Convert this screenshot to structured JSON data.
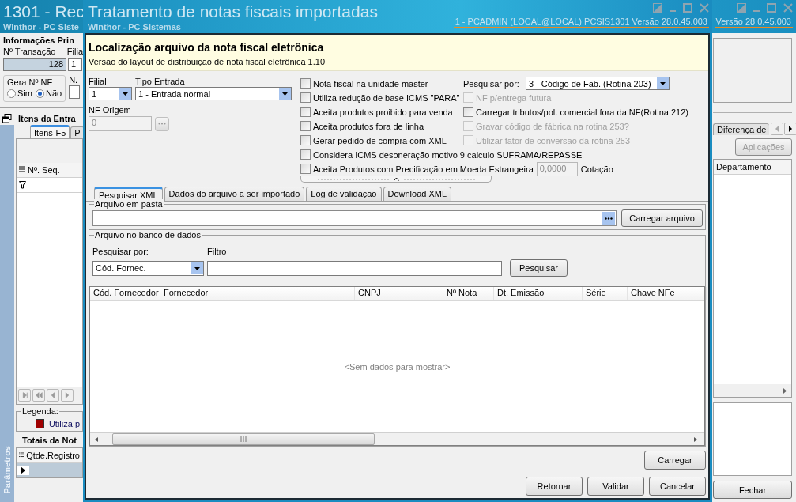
{
  "background_window": {
    "title": "1301 - Rec",
    "subtitle": "Winthor - PC Siste",
    "version": "Versão  28.0.45.003",
    "left": {
      "section_title": "Informações Prin",
      "transacao_label": "Nº Transação",
      "transacao_value": "128",
      "filial_label": "Filia",
      "filial_value": "1",
      "gera_nf_title": "Gera Nº NF",
      "gera_nf_options": [
        {
          "label": "Sim",
          "selected": false
        },
        {
          "label": "Não",
          "selected": true
        }
      ],
      "n_label": "N.",
      "itens_title": "Itens da Entra",
      "tabs": [
        {
          "label": "Itens-F5",
          "selected": true
        },
        {
          "label": "P",
          "selected": false
        }
      ],
      "grid_column": "Nº. Seq.",
      "legend_title": "Legenda:",
      "legend_items": [
        {
          "label": "Utiliza p",
          "color": "#a00000"
        }
      ],
      "totais_title": "Totais da Not",
      "totais_column": "Qtde.Registro",
      "side_tab": "Parâmetros"
    },
    "right": {
      "tab": "Diferença de",
      "button": "Aplicações",
      "grid_column": "Departamento",
      "close_button": "Fechar"
    }
  },
  "dialog": {
    "title": "Tratamento de notas fiscais importadas",
    "subtitle": "Winthor - PC Sistemas",
    "status": "1 - PCADMIN (LOCAL@LOCAL)   PCSIS1301  Versão  28.0.45.003",
    "header_title": "Localização arquivo da nota fiscal eletrônica",
    "header_subtitle": "Versão do layout de distribuição de nota fiscal eletrônica 1.10",
    "filial": {
      "label": "Filial",
      "value": "1"
    },
    "tipo_entrada": {
      "label": "Tipo Entrada",
      "value": "1 - Entrada normal"
    },
    "nf_origem": {
      "label": "NF Origem",
      "value": "0"
    },
    "left_checkboxes": [
      {
        "label": "Nota fiscal na unidade master",
        "checked": false,
        "disabled": false
      },
      {
        "label": "Utiliza redução de base ICMS \"PARA\"",
        "checked": false,
        "disabled": false
      },
      {
        "label": "Aceita produtos proibido para venda",
        "checked": false,
        "disabled": false
      },
      {
        "label": "Aceita produtos fora de linha",
        "checked": false,
        "disabled": false
      },
      {
        "label": "Gerar pedido de compra com XML",
        "checked": false,
        "disabled": false
      },
      {
        "label": "Considera ICMS desoneração motivo 9 calculo SUFRAMA/REPASSE",
        "checked": false,
        "disabled": false
      },
      {
        "label": "Aceita Produtos com Precificação em Moeda Estrangeira",
        "checked": false,
        "disabled": false
      }
    ],
    "pesquisar_por": {
      "label": "Pesquisar por:",
      "value": "3 - Código de Fab. (Rotina 203)"
    },
    "right_checkboxes": [
      {
        "label": "NF p/entrega futura",
        "checked": false,
        "disabled": true
      },
      {
        "label": "Carregar tributos/pol. comercial fora da NF(Rotina 212)",
        "checked": false,
        "disabled": false
      },
      {
        "label": "Gravar código de fábrica na rotina 253?",
        "checked": false,
        "disabled": true
      },
      {
        "label": "Utilizar fator de conversão da rotina 253",
        "checked": false,
        "disabled": true
      }
    ],
    "cotacao": {
      "value": "0,0000",
      "label": "Cotação"
    },
    "tabs": [
      {
        "label": "Pesquisar XML",
        "selected": true
      },
      {
        "label": "Dados do arquivo a ser importado",
        "selected": false
      },
      {
        "label": "Log de validação",
        "selected": false
      },
      {
        "label": "Download XML",
        "selected": false
      }
    ],
    "arquivo_em_pasta": {
      "title": "Arquivo em pasta",
      "button": "Carregar arquivo"
    },
    "banco": {
      "title": "Arquivo no banco de dados",
      "search_label": "Pesquisar por:",
      "search_value": "Cód. Fornec.",
      "filter_label": "Filtro",
      "button": "Pesquisar"
    },
    "table": {
      "columns": [
        "Cód. Fornecedor",
        "Fornecedor",
        "CNPJ",
        "Nº Nota",
        "Dt. Emissão",
        "Série",
        "Chave NFe"
      ],
      "empty_message": "<Sem dados para mostrar>"
    },
    "load_button": "Carregar",
    "buttons": [
      "Retornar",
      "Validar",
      "Cancelar"
    ]
  }
}
